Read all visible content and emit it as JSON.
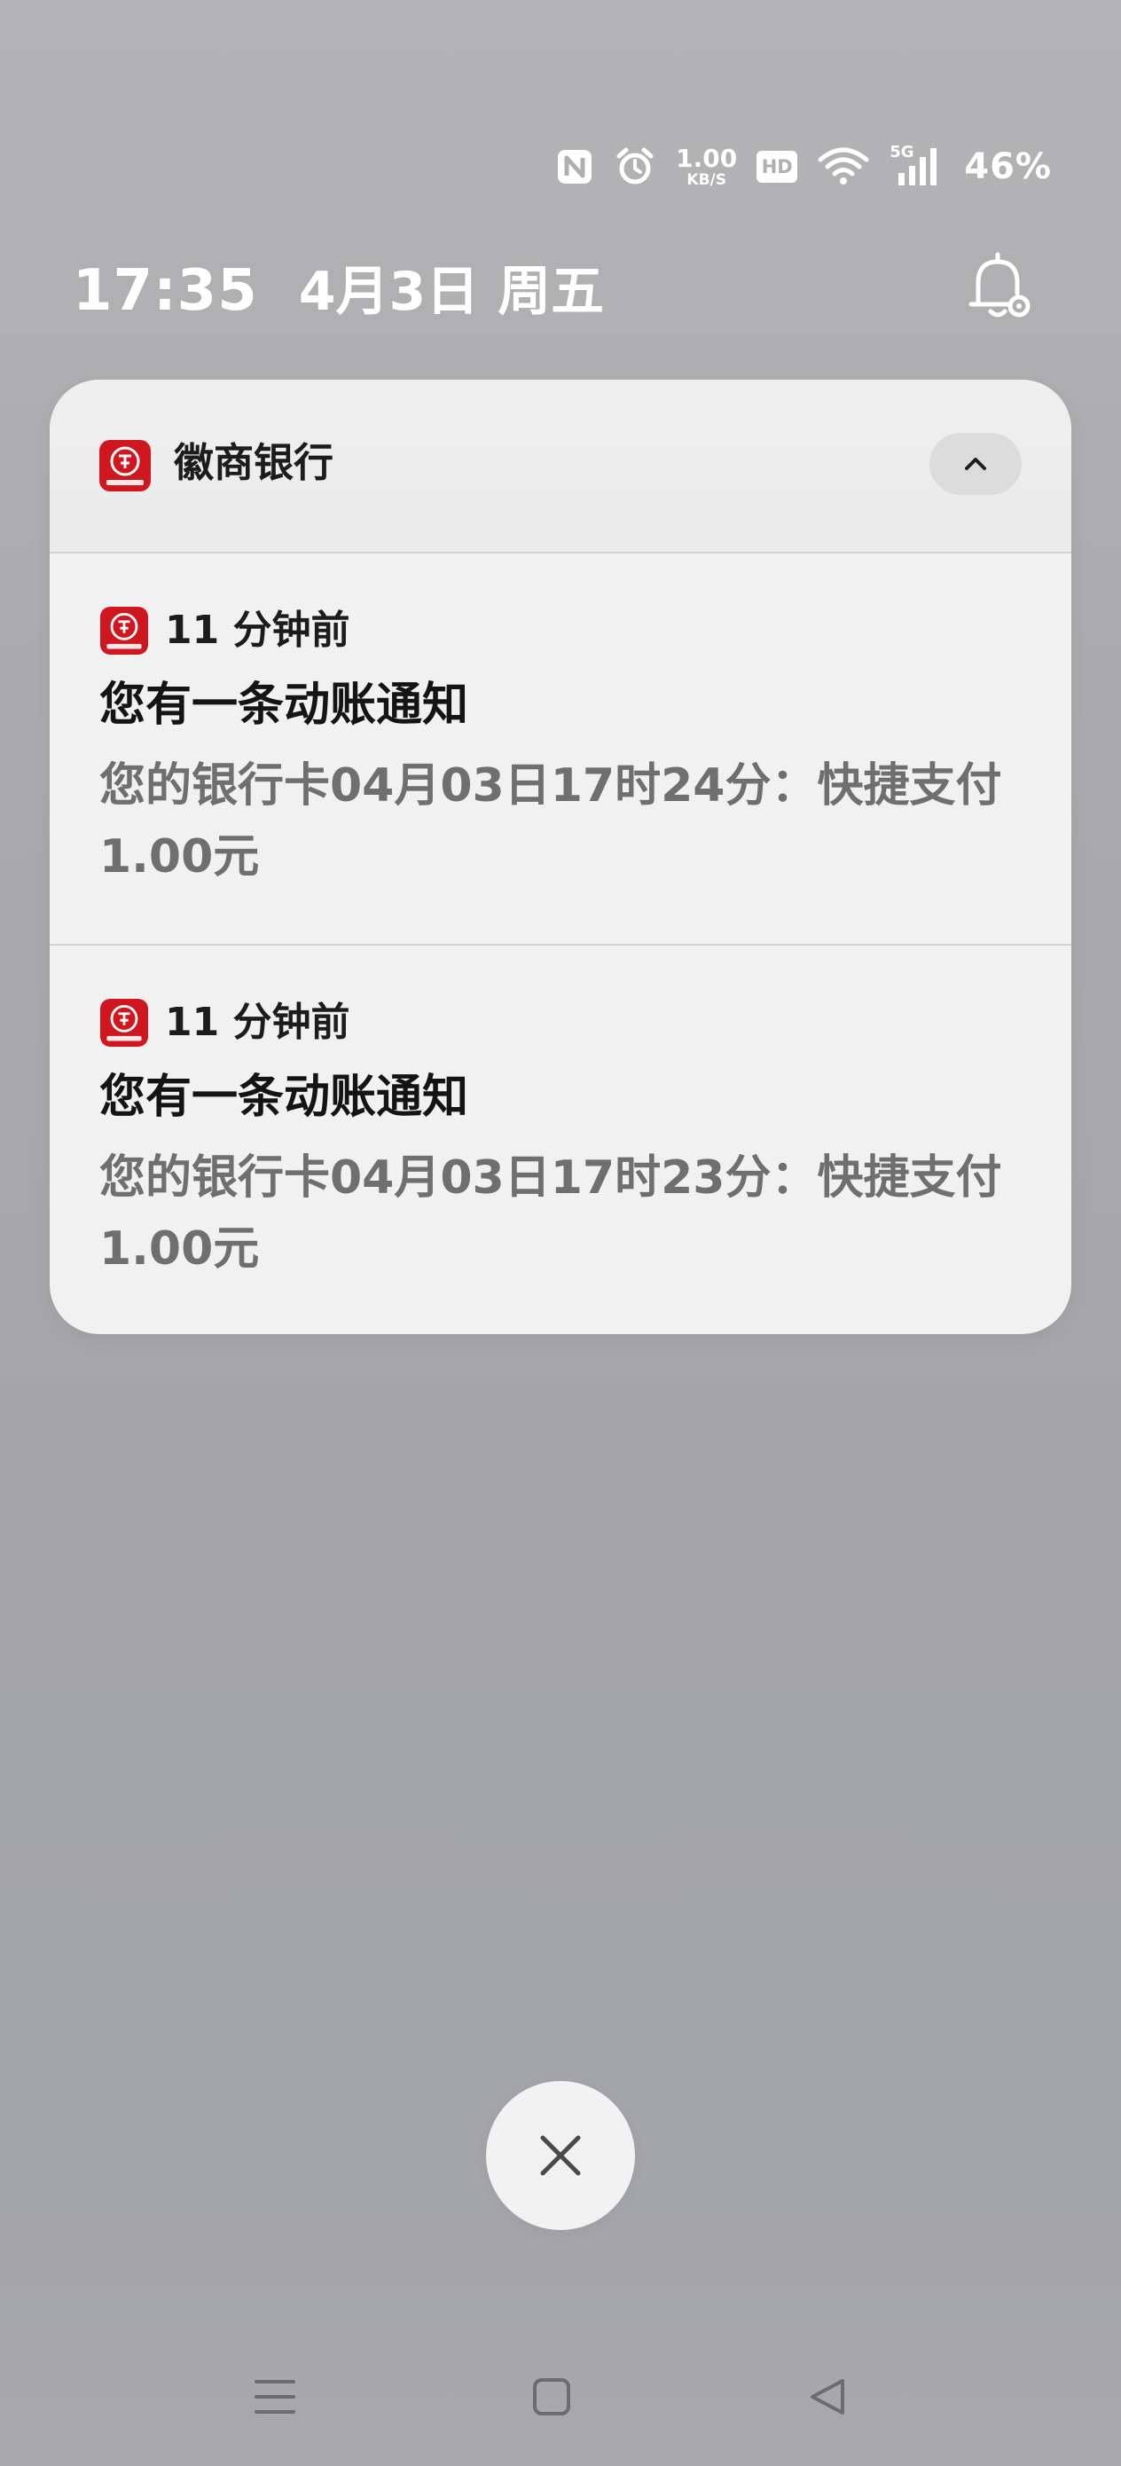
{
  "status_bar": {
    "nfc_icon": "nfc-icon",
    "alarm_icon": "alarm-icon",
    "net_speed_value": "1.00",
    "net_speed_unit": "KB/S",
    "hd_label": "HD",
    "wifi_icon": "wifi-icon",
    "network_label": "5G",
    "signal_icon": "signal-icon",
    "battery": "46%"
  },
  "header": {
    "time": "17:35",
    "date": "4月3日 周五",
    "settings_icon": "notification-settings-icon"
  },
  "notification_group": {
    "app_name": "徽商银行",
    "app_icon": "huishang-bank-logo-icon",
    "brand_color": "#d0161f",
    "collapse_icon": "chevron-up-icon",
    "items": [
      {
        "time_ago": "11 分钟前",
        "title": "您有一条动账通知",
        "body": "您的银行卡04月03日17时24分：快捷支付1.00元"
      },
      {
        "time_ago": "11 分钟前",
        "title": "您有一条动账通知",
        "body": "您的银行卡04月03日17时23分：快捷支付1.00元"
      }
    ]
  },
  "dismiss": {
    "icon": "close-icon"
  },
  "nav_bar": {
    "menu_icon": "menu-icon",
    "home_icon": "home-icon",
    "back_icon": "back-icon"
  }
}
